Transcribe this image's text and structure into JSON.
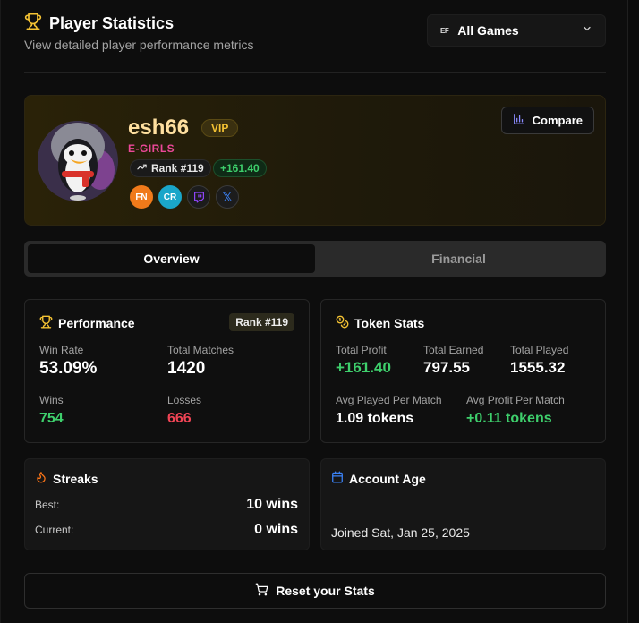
{
  "header": {
    "title": "Player Statistics",
    "subtitle": "View detailed player performance metrics",
    "game_select": {
      "badge": "EF",
      "value": "All Games"
    }
  },
  "profile": {
    "username": "esh66",
    "vip_label": "VIP",
    "team": "E-GIRLS",
    "rank": "Rank #119",
    "profit": "+161.40",
    "socials": [
      {
        "name": "fortnite",
        "label": "FN"
      },
      {
        "name": "clash-royale",
        "label": "CR"
      },
      {
        "name": "twitch",
        "label": ""
      },
      {
        "name": "x",
        "label": "𝕏"
      }
    ],
    "compare_label": "Compare"
  },
  "tabs": [
    {
      "label": "Overview",
      "active": true
    },
    {
      "label": "Financial",
      "active": false
    }
  ],
  "performance": {
    "title": "Performance",
    "rank": "Rank #119",
    "win_rate_label": "Win Rate",
    "win_rate": "53.09%",
    "total_matches_label": "Total Matches",
    "total_matches": "1420",
    "wins_label": "Wins",
    "wins": "754",
    "losses_label": "Losses",
    "losses": "666"
  },
  "token_stats": {
    "title": "Token Stats",
    "total_profit_label": "Total Profit",
    "total_profit": "+161.40",
    "total_earned_label": "Total Earned",
    "total_earned": "797.55",
    "total_played_label": "Total Played",
    "total_played": "1555.32",
    "avg_played_label": "Avg Played Per Match",
    "avg_played": "1.09 tokens",
    "avg_profit_label": "Avg Profit Per Match",
    "avg_profit": "+0.11 tokens"
  },
  "streaks": {
    "title": "Streaks",
    "best_label": "Best:",
    "best": "10 wins",
    "current_label": "Current:",
    "current": "0 wins"
  },
  "account_age": {
    "title": "Account Age",
    "joined": "Joined Sat, Jan 25, 2025"
  },
  "reset_label": "Reset your Stats",
  "colors": {
    "accent_gold": "#f4c233",
    "positive": "#3ecf6c",
    "negative": "#f04455",
    "team": "#ec4899"
  }
}
